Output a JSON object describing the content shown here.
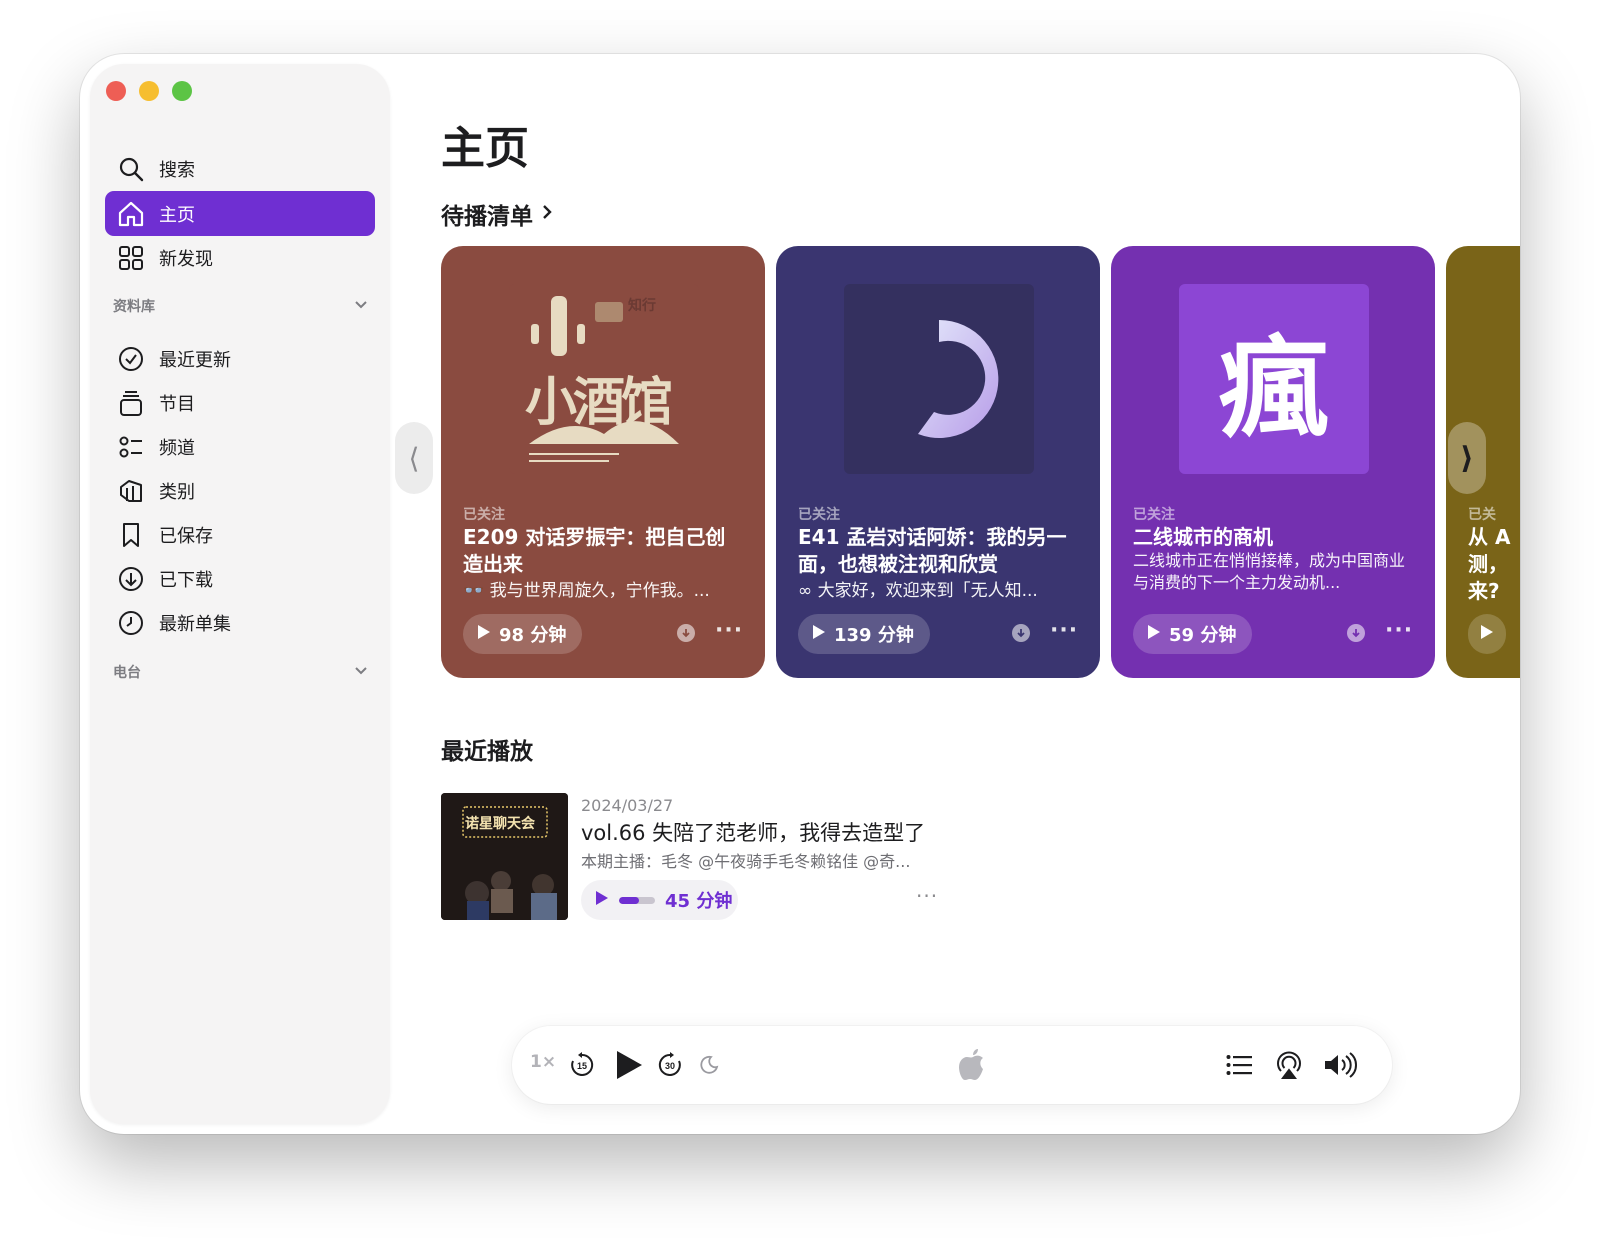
{
  "sidebar": {
    "nav": [
      {
        "label": "搜索",
        "icon": "search-icon"
      },
      {
        "label": "主页",
        "icon": "home-icon",
        "active": true
      },
      {
        "label": "新发现",
        "icon": "grid-icon"
      }
    ],
    "library_header": "资料库",
    "library": [
      {
        "label": "最近更新",
        "icon": "checkmark-circle-icon"
      },
      {
        "label": "节目",
        "icon": "stack-icon"
      },
      {
        "label": "频道",
        "icon": "list-icon"
      },
      {
        "label": "类别",
        "icon": "category-icon"
      },
      {
        "label": "已保存",
        "icon": "bookmark-icon"
      },
      {
        "label": "已下载",
        "icon": "download-circle-icon"
      },
      {
        "label": "最新单集",
        "icon": "clock-icon"
      }
    ],
    "radio_header": "电台"
  },
  "main": {
    "title": "主页",
    "up_next_title": "待播清单",
    "cards": [
      {
        "follow": "已关注",
        "artwork_text": "小酒馆",
        "artwork_badge": "知行",
        "title": "E209 对话罗振宇：把自己创造出来",
        "desc": "👓 我与世界周旋久，宁作我。...",
        "duration": "98 分钟",
        "bg": "#8a4b40"
      },
      {
        "follow": "已关注",
        "title": "E41 孟岩对话阿娇：我的另一面，也想被注视和欣赏",
        "desc": "∞ 大家好，欢迎来到「无人知...",
        "duration": "139 分钟",
        "bg": "#3a3570"
      },
      {
        "follow": "已关注",
        "artwork_text": "瘋",
        "title": "二线城市的商机",
        "desc": "二线城市正在悄悄接棒，成为中国商业与消费的下一个主力发动机...",
        "duration": "59 分钟",
        "bg": "#7430b0"
      },
      {
        "follow": "已关",
        "title": "从 A 测，来?",
        "bg": "#7a6418"
      }
    ],
    "recent_title": "最近播放",
    "recent": {
      "thumb_text": "诺星聊天会",
      "date": "2024/03/27",
      "title": "vol.66 失陪了范老师，我得去造型了",
      "desc": "本期主播：毛冬 @午夜骑手毛冬赖铭佳 @奇...",
      "duration": "45 分钟",
      "progress": 0.55
    }
  },
  "player": {
    "speed": "1×",
    "skip_back": "15",
    "skip_forward": "30"
  },
  "colors": {
    "accent": "#6f2fd2"
  }
}
